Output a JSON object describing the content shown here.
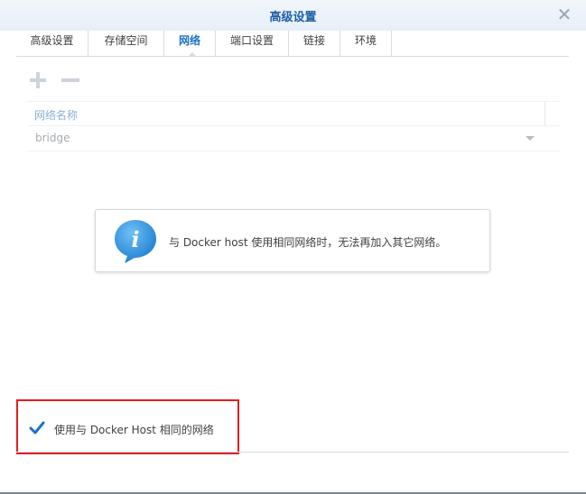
{
  "window": {
    "title": "高级设置"
  },
  "tabs": [
    {
      "label": "高级设置"
    },
    {
      "label": "存储空间"
    },
    {
      "label": "网络"
    },
    {
      "label": "端口设置"
    },
    {
      "label": "链接"
    },
    {
      "label": "环境"
    }
  ],
  "active_tab": "网络",
  "toolbar": {
    "add_icon": "plus-icon",
    "remove_icon": "minus-icon"
  },
  "network_grid": {
    "column_header": "网络名称",
    "rows": [
      {
        "name": "bridge"
      }
    ]
  },
  "info": {
    "icon": "info-bubble-icon",
    "message": "与 Docker host 使用相同网络时，无法再加入其它网络。"
  },
  "host_network_option": {
    "label": "使用与 Docker Host 相同的网络",
    "checked": true
  },
  "colors": {
    "accent": "#1d72c8",
    "highlight_border": "#e31d1d",
    "info_icon": "#2a8fe0"
  }
}
